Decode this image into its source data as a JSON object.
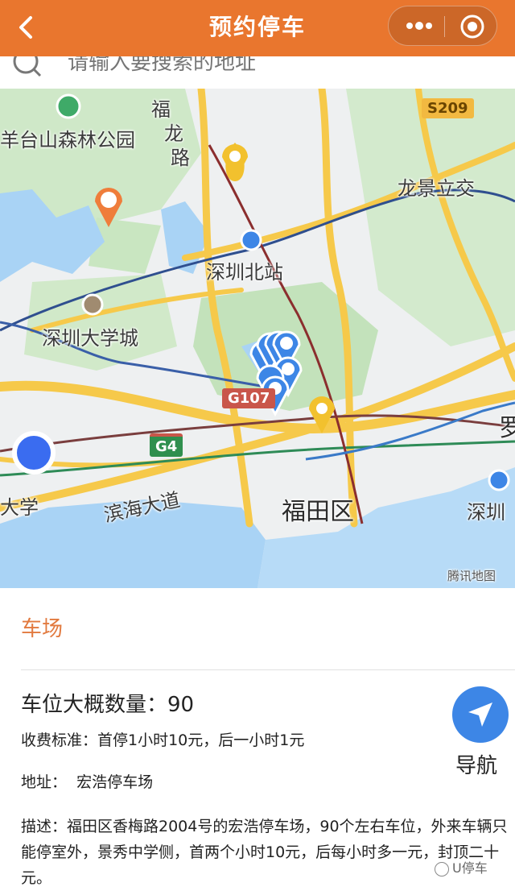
{
  "header": {
    "title": "预约停车",
    "back_icon": "chevron-left-icon",
    "more_icon": "more-dots-icon",
    "close_icon": "target-circle-icon",
    "color": "#e9762e"
  },
  "search": {
    "placeholder": "请输入要搜索的地址"
  },
  "map": {
    "labels": {
      "park": "羊台山森林公园",
      "fulong_a": "福",
      "fulong_b": "龙",
      "fulong_c": "路",
      "s209": "S209",
      "longjing": "龙景立交",
      "north_station": "深圳北站",
      "university_town": "深圳大学城",
      "g107": "G107",
      "g4": "G4",
      "xue": "大学",
      "binhai": "滨海大道",
      "futian": "福田区",
      "shenzhen_right": "深圳",
      "luo": "罗",
      "tencent": "腾讯地图"
    },
    "colors": {
      "water": "#a9d3f5",
      "green": "#c7e6c0",
      "road_yellow": "#f6c94a",
      "marker_blue": "#3d86e6",
      "marker_yellow": "#f2c12e",
      "location_dot": "#3a6cf0"
    }
  },
  "section": {
    "title": "车场"
  },
  "detail": {
    "count_label": "车位大概数量：",
    "count_value": "90",
    "fee": "收费标准：首停1小时10元，后一小时1元",
    "address_label": "地址：",
    "address_value": "宏浩停车场",
    "description": "描述：福田区香梅路2004号的宏浩停车场，90个左右车位，外来车辆只能停室外，景秀中学侧，首两个小时10元，后每小时多一元，封顶二十元。"
  },
  "nav": {
    "label": "导航",
    "icon": "navigation-arrow-icon"
  },
  "watermark": "U停车"
}
